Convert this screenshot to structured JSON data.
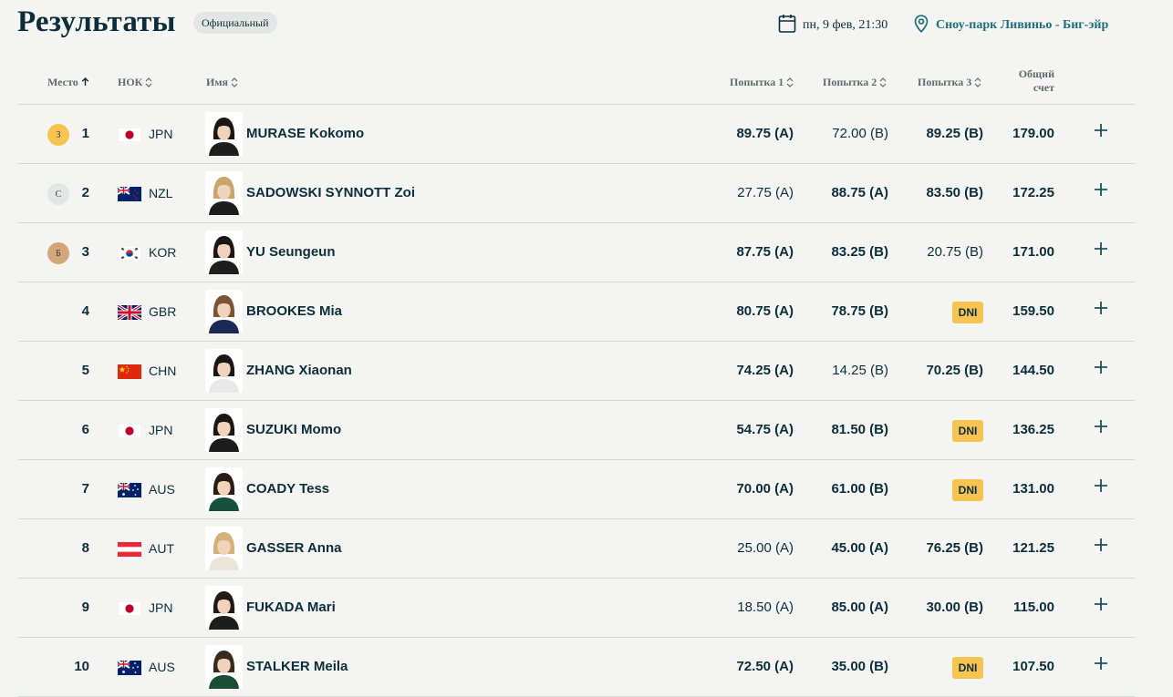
{
  "header": {
    "title": "Результаты",
    "badge": "Официальный",
    "date": "пн, 9 фев, 21:30",
    "venue": "Сноу-парк Ливиньо - Биг-эйр"
  },
  "columns": {
    "place": "Место",
    "noc": "НОК",
    "name": "Имя",
    "run1": "Попытка 1",
    "run2": "Попытка 2",
    "run3": "Попытка 3",
    "total_line1": "Общий",
    "total_line2": "счет"
  },
  "colors": {
    "text": "#0c2d3a",
    "accent": "#1e6f7c",
    "gold": "#f8c451",
    "silver": "#e3e5e6",
    "bronze": "#d4a77a",
    "dni": "#f8c451"
  },
  "rows": [
    {
      "medal": "З",
      "medal_color": "#f8c451",
      "rank": "1",
      "noc": "JPN",
      "flag": "jpn",
      "name": "MURASE Kokomo",
      "r1": "89.75 (A)",
      "r1_bold": true,
      "r2": "72.00 (B)",
      "r2_bold": false,
      "r3": "89.25 (B)",
      "r3_bold": true,
      "r3_dni": false,
      "total": "179.00"
    },
    {
      "medal": "С",
      "medal_color": "#e3e5e6",
      "rank": "2",
      "noc": "NZL",
      "flag": "nzl",
      "name": "SADOWSKI SYNNOTT Zoi",
      "r1": "27.75 (A)",
      "r1_bold": false,
      "r2": "88.75 (A)",
      "r2_bold": true,
      "r3": "83.50 (B)",
      "r3_bold": true,
      "r3_dni": false,
      "total": "172.25"
    },
    {
      "medal": "Б",
      "medal_color": "#d4a77a",
      "rank": "3",
      "noc": "KOR",
      "flag": "kor",
      "name": "YU Seungeun",
      "r1": "87.75 (A)",
      "r1_bold": true,
      "r2": "83.25 (B)",
      "r2_bold": true,
      "r3": "20.75 (B)",
      "r3_bold": false,
      "r3_dni": false,
      "total": "171.00"
    },
    {
      "medal": "",
      "medal_color": "",
      "rank": "4",
      "noc": "GBR",
      "flag": "gbr",
      "name": "BROOKES Mia",
      "r1": "80.75 (A)",
      "r1_bold": true,
      "r2": "78.75 (B)",
      "r2_bold": true,
      "r3": "DNI",
      "r3_bold": false,
      "r3_dni": true,
      "total": "159.50"
    },
    {
      "medal": "",
      "medal_color": "",
      "rank": "5",
      "noc": "CHN",
      "flag": "chn",
      "name": "ZHANG Xiaonan",
      "r1": "74.25 (A)",
      "r1_bold": true,
      "r2": "14.25 (B)",
      "r2_bold": false,
      "r3": "70.25 (B)",
      "r3_bold": true,
      "r3_dni": false,
      "total": "144.50"
    },
    {
      "medal": "",
      "medal_color": "",
      "rank": "6",
      "noc": "JPN",
      "flag": "jpn",
      "name": "SUZUKI Momo",
      "r1": "54.75 (A)",
      "r1_bold": true,
      "r2": "81.50 (B)",
      "r2_bold": true,
      "r3": "DNI",
      "r3_bold": false,
      "r3_dni": true,
      "total": "136.25"
    },
    {
      "medal": "",
      "medal_color": "",
      "rank": "7",
      "noc": "AUS",
      "flag": "aus",
      "name": "COADY Tess",
      "r1": "70.00 (A)",
      "r1_bold": true,
      "r2": "61.00 (B)",
      "r2_bold": true,
      "r3": "DNI",
      "r3_bold": false,
      "r3_dni": true,
      "total": "131.00"
    },
    {
      "medal": "",
      "medal_color": "",
      "rank": "8",
      "noc": "AUT",
      "flag": "aut",
      "name": "GASSER Anna",
      "r1": "25.00 (A)",
      "r1_bold": false,
      "r2": "45.00 (A)",
      "r2_bold": true,
      "r3": "76.25 (B)",
      "r3_bold": true,
      "r3_dni": false,
      "total": "121.25"
    },
    {
      "medal": "",
      "medal_color": "",
      "rank": "9",
      "noc": "JPN",
      "flag": "jpn",
      "name": "FUKADA Mari",
      "r1": "18.50 (A)",
      "r1_bold": false,
      "r2": "85.00 (A)",
      "r2_bold": true,
      "r3": "30.00 (B)",
      "r3_bold": true,
      "r3_dni": false,
      "total": "115.00"
    },
    {
      "medal": "",
      "medal_color": "",
      "rank": "10",
      "noc": "AUS",
      "flag": "aus",
      "name": "STALKER Meila",
      "r1": "72.50 (A)",
      "r1_bold": true,
      "r2": "35.00 (B)",
      "r2_bold": true,
      "r3": "DNI",
      "r3_bold": false,
      "r3_dni": true,
      "total": "107.50"
    }
  ]
}
